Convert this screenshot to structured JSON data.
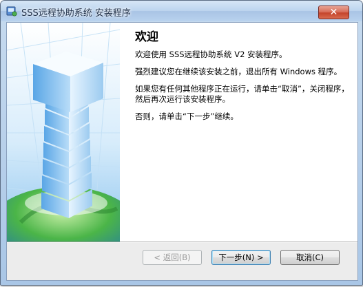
{
  "window": {
    "title": "SSS远程协助系统 安装程序",
    "close_label": "✕"
  },
  "welcome": {
    "heading": "欢迎",
    "paragraphs": [
      "欢迎使用 SSS远程协助系统 V2 安装程序。",
      "强烈建议您在继续该安装之前，退出所有 Windows 程序。",
      "如果您有任何其他程序正在运行，请单击“取消”，关闭程序，然后再次运行该安装程序。",
      "否则，请单击“下一步”继续。"
    ]
  },
  "buttons": {
    "back": "< 返回(B)",
    "next": "下一步(N) >",
    "cancel": "取消(C)"
  },
  "icons": {
    "app": "installer-icon",
    "banner": "server-tower-globe-image"
  }
}
